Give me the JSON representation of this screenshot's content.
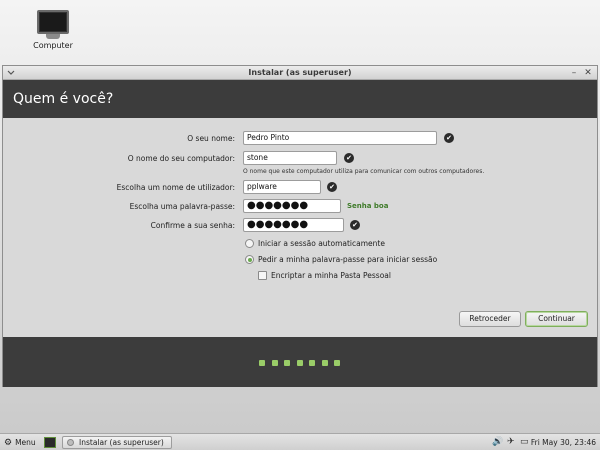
{
  "desktop": {
    "icon_label": "Computer"
  },
  "window": {
    "title": "Instalar (as superuser)",
    "header": "Quem é você?"
  },
  "form": {
    "name_label": "O seu nome:",
    "name_value": "Pedro Pinto",
    "computer_label": "O nome do seu computador:",
    "computer_value": "stone",
    "computer_hint": "O nome que este computador utiliza para comunicar com outros computadores.",
    "username_label": "Escolha um nome de utilizador:",
    "username_value": "pplware",
    "password_label": "Escolha uma palavra-passe:",
    "password_value": "●●●●●●●",
    "password_strength": "Senha boa",
    "confirm_label": "Confirme a sua senha:",
    "confirm_value": "●●●●●●●",
    "opt_autologin": "Iniciar a sessão automaticamente",
    "opt_require_password": "Pedir a minha palavra-passe para iniciar sessão",
    "opt_encrypt": "Encriptar a minha Pasta Pessoal",
    "selected_option": "opt_require_password"
  },
  "buttons": {
    "back": "Retroceder",
    "continue": "Continuar"
  },
  "progress": {
    "steps_total": 7
  },
  "panel": {
    "menu_label": "Menu",
    "task_label": "Instalar (as superuser)",
    "clock": "Fri May 30, 23:46"
  },
  "colors": {
    "accent": "#9acd68",
    "dark_band": "#3c3c3c",
    "strength": "#3f7b2a"
  }
}
